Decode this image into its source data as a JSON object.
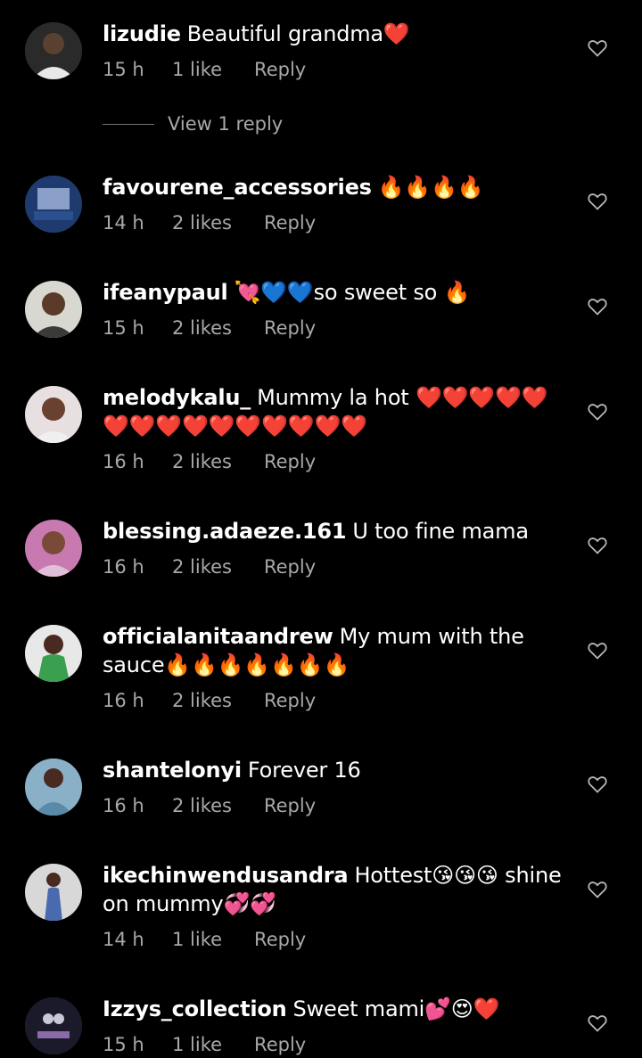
{
  "comments": [
    {
      "username": "lizudie",
      "text": "Beautiful grandma❤️",
      "time": "15 h",
      "likes": "1 like",
      "reply": "Reply",
      "avatar_color": "#2a2a2a"
    },
    {
      "username": "favourene_accessories",
      "text": "🔥🔥🔥🔥",
      "time": "14 h",
      "likes": "2 likes",
      "reply": "Reply",
      "avatar_color": "#1e3a6e"
    },
    {
      "username": "ifeanypaul",
      "text": "💘💙💙so sweet so 🔥",
      "time": "15 h",
      "likes": "2 likes",
      "reply": "Reply",
      "avatar_color": "#d8d8d0"
    },
    {
      "username": "melodykalu_",
      "text": "Mummy la hot ❤️❤️❤️❤️❤️❤️❤️❤️❤️❤️❤️❤️❤️❤️❤️",
      "time": "16 h",
      "likes": "2 likes",
      "reply": "Reply",
      "avatar_color": "#9a6a5a"
    },
    {
      "username": "blessing.adaeze.161",
      "text": "U too fine mama",
      "time": "16 h",
      "likes": "2 likes",
      "reply": "Reply",
      "avatar_color": "#c87ab0"
    },
    {
      "username": "officialanitaandrew",
      "text": "My mum with the sauce🔥🔥🔥🔥🔥🔥🔥",
      "time": "16 h",
      "likes": "2 likes",
      "reply": "Reply",
      "avatar_color": "#3aa050"
    },
    {
      "username": "shantelonyi",
      "text": "Forever 16",
      "time": "16 h",
      "likes": "2 likes",
      "reply": "Reply",
      "avatar_color": "#5a8aa8"
    },
    {
      "username": "ikechinwendusandra",
      "text": "Hottest😘😘😘 shine on mummy💞💞",
      "time": "14 h",
      "likes": "1 like",
      "reply": "Reply",
      "avatar_color": "#c8c8c8"
    },
    {
      "username": "Izzys_collection",
      "text": "Sweet mami💕😍❤️",
      "time": "15 h",
      "likes": "1 like",
      "reply": "Reply",
      "avatar_color": "#1a1a2a"
    }
  ],
  "view_replies": "View 1 reply",
  "colors": {
    "background": "#000000",
    "meta": "#a8a8a8",
    "text": "#ffffff"
  }
}
